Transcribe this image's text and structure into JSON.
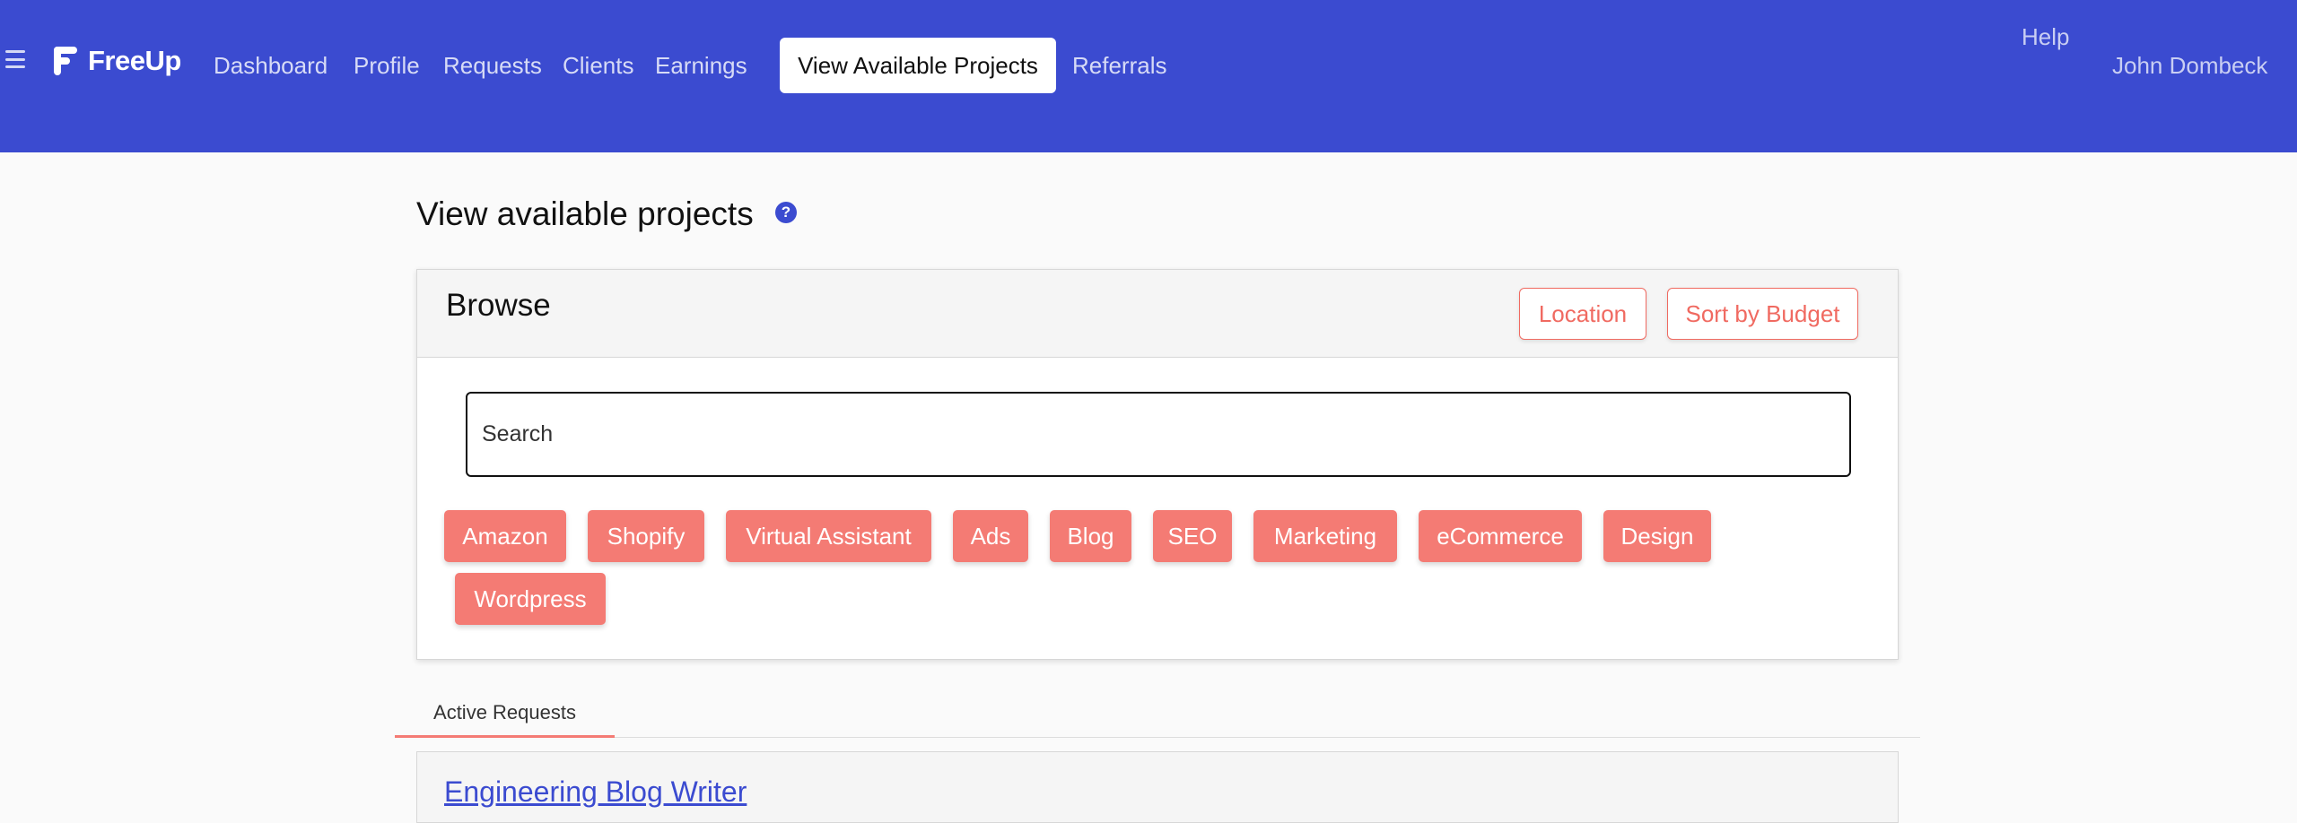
{
  "header": {
    "logo_text": "FreeUp",
    "nav": [
      {
        "label": "Dashboard"
      },
      {
        "label": "Profile"
      },
      {
        "label": "Requests"
      },
      {
        "label": "Clients"
      },
      {
        "label": "Earnings"
      },
      {
        "label": "View Available Projects",
        "active": true
      },
      {
        "label": "Referrals"
      }
    ],
    "help_label": "Help",
    "user_name": "John Dombeck"
  },
  "page": {
    "title": "View available projects",
    "help_icon_glyph": "?"
  },
  "browse": {
    "title": "Browse",
    "location_label": "Location",
    "sort_label": "Sort by Budget",
    "search_placeholder": "Search",
    "tags": [
      "Amazon",
      "Shopify",
      "Virtual Assistant",
      "Ads",
      "Blog",
      "SEO",
      "Marketing",
      "eCommerce",
      "Design",
      "Wordpress"
    ]
  },
  "tabs": {
    "active_label": "Active Requests"
  },
  "requests": [
    {
      "title": "Engineering Blog Writer"
    }
  ],
  "colors": {
    "brand_blue": "#3b4bd0",
    "accent_coral": "#f47b74",
    "accent_outline": "#f06a61"
  },
  "icons": {
    "menu": "hamburger-menu-icon",
    "help": "question-circle-icon",
    "logo": "freeup-logo-icon"
  }
}
